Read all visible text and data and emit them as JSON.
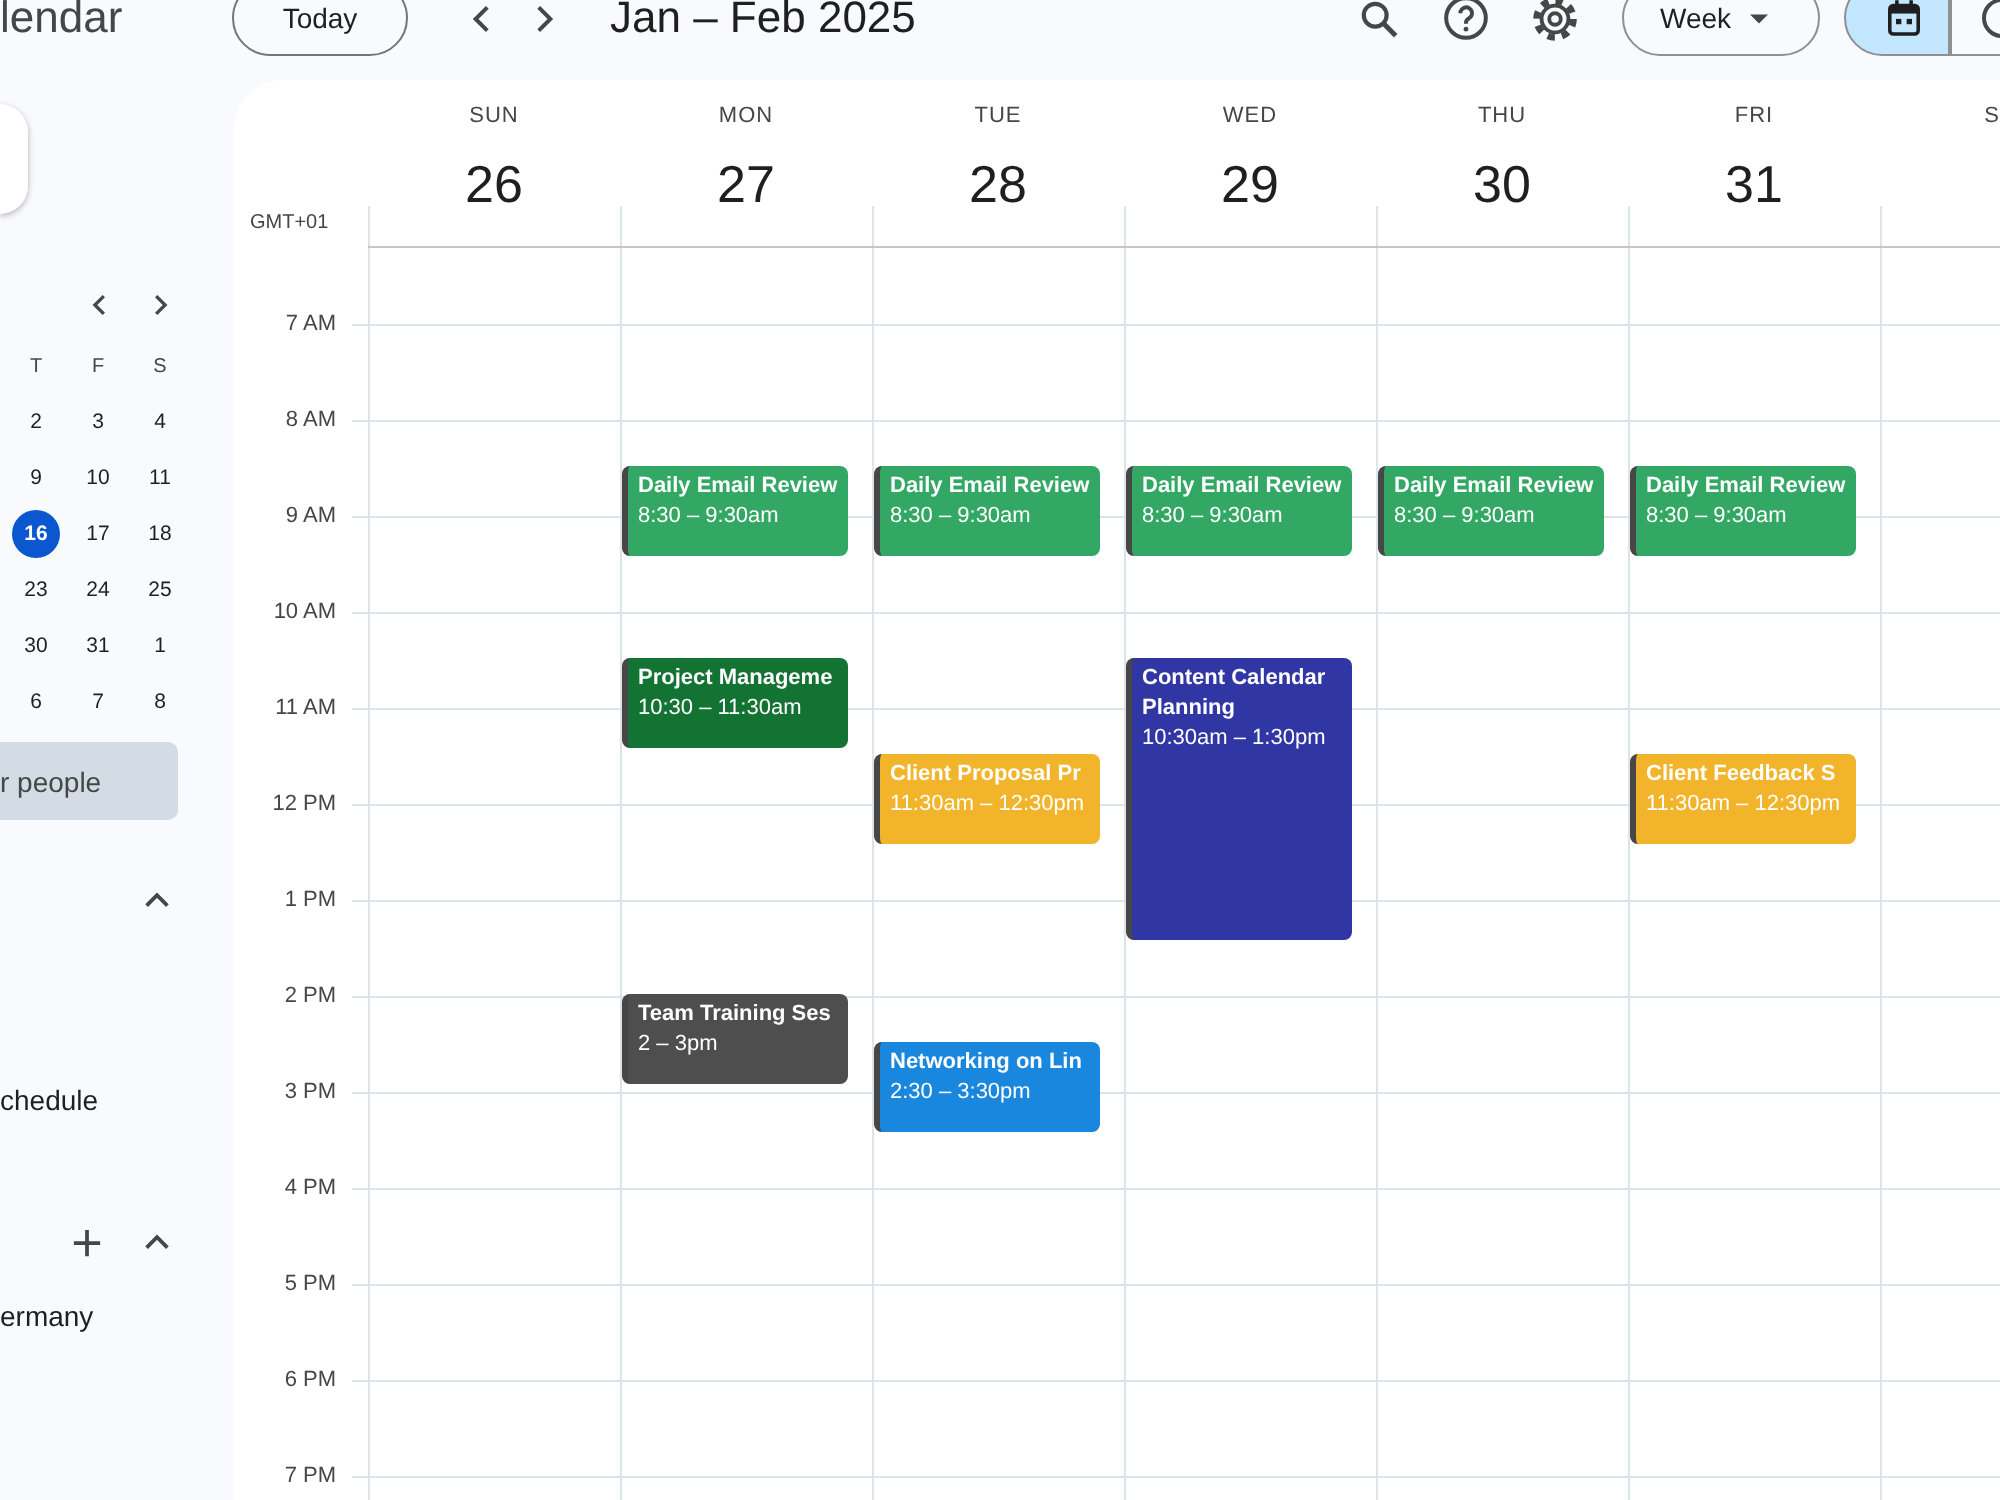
{
  "top_bar": {
    "app_name": "lendar",
    "today_button": "Today",
    "period_title": "Jan – Feb 2025",
    "view_dropdown": "Week",
    "view_switch": [
      {
        "kind": "calendar",
        "selected": true
      },
      {
        "kind": "tasks",
        "selected": false
      }
    ]
  },
  "sidebar": {
    "mini_calendar": {
      "weekdays": [
        "T",
        "F",
        "S"
      ],
      "weeks": [
        [
          {
            "day": "2",
            "selected": false
          },
          {
            "day": "3",
            "selected": false
          },
          {
            "day": "4",
            "selected": false
          }
        ],
        [
          {
            "day": "9",
            "selected": false
          },
          {
            "day": "10",
            "selected": false
          },
          {
            "day": "11",
            "selected": false
          }
        ],
        [
          {
            "day": "16",
            "selected": true
          },
          {
            "day": "17",
            "selected": false
          },
          {
            "day": "18",
            "selected": false
          }
        ],
        [
          {
            "day": "23",
            "selected": false
          },
          {
            "day": "24",
            "selected": false
          },
          {
            "day": "25",
            "selected": false
          }
        ],
        [
          {
            "day": "30",
            "selected": false
          },
          {
            "day": "31",
            "selected": false
          },
          {
            "day": "1",
            "selected": false
          }
        ],
        [
          {
            "day": "6",
            "selected": false
          },
          {
            "day": "7",
            "selected": false
          },
          {
            "day": "8",
            "selected": false
          }
        ]
      ]
    },
    "people_search": {
      "placeholder": "r people"
    },
    "sections": [
      {
        "expanded": true,
        "add_button": false,
        "items": [
          "chedule"
        ]
      },
      {
        "expanded": true,
        "add_button": true,
        "items": [
          "ermany"
        ]
      }
    ]
  },
  "calendar": {
    "timezone": "GMT+01",
    "days": [
      {
        "weekday": "SUN",
        "date": "26"
      },
      {
        "weekday": "MON",
        "date": "27",
        "events": [
          {
            "title": "Daily Email Review",
            "time": "8:30 – 9:30am",
            "color": "#33a865"
          },
          {
            "title": "Project Manageme",
            "time": "10:30 – 11:30am",
            "color": "#137333"
          },
          {
            "title": "Team Training Ses",
            "time": "2 – 3pm",
            "color": "#4e4e4e"
          }
        ]
      },
      {
        "weekday": "TUE",
        "date": "28",
        "events": [
          {
            "title": "Daily Email Review",
            "time": "8:30 – 9:30am",
            "color": "#33a865"
          },
          {
            "title": "Client Proposal Pr",
            "time": "11:30am – 12:30pm",
            "color": "#f2b42a"
          },
          {
            "title": "Networking on Lin",
            "time": "2:30 – 3:30pm",
            "color": "#1a87df"
          }
        ]
      },
      {
        "weekday": "WED",
        "date": "29",
        "events": [
          {
            "title": "Daily Email Review",
            "time": "8:30 – 9:30am",
            "color": "#33a865"
          },
          {
            "title": "Content Calendar Planning",
            "time": "10:30am – 1:30pm",
            "color": "#3037a5"
          }
        ]
      },
      {
        "weekday": "THU",
        "date": "30",
        "events": [
          {
            "title": "Daily Email Review",
            "time": "8:30 – 9:30am",
            "color": "#33a865"
          }
        ]
      },
      {
        "weekday": "FRI",
        "date": "31",
        "events": [
          {
            "title": "Daily Email Review",
            "time": "8:30 – 9:30am",
            "color": "#33a865"
          },
          {
            "title": "Client Feedback S",
            "time": "11:30am – 12:30pm",
            "color": "#f2b42a"
          }
        ]
      },
      {
        "weekday": "S"
      }
    ],
    "hours": [
      "7 AM",
      "8 AM",
      "9 AM",
      "10 AM",
      "11 AM",
      "12 PM",
      "1 PM",
      "2 PM",
      "3 PM",
      "4 PM",
      "5 PM",
      "6 PM",
      "7 PM"
    ]
  }
}
